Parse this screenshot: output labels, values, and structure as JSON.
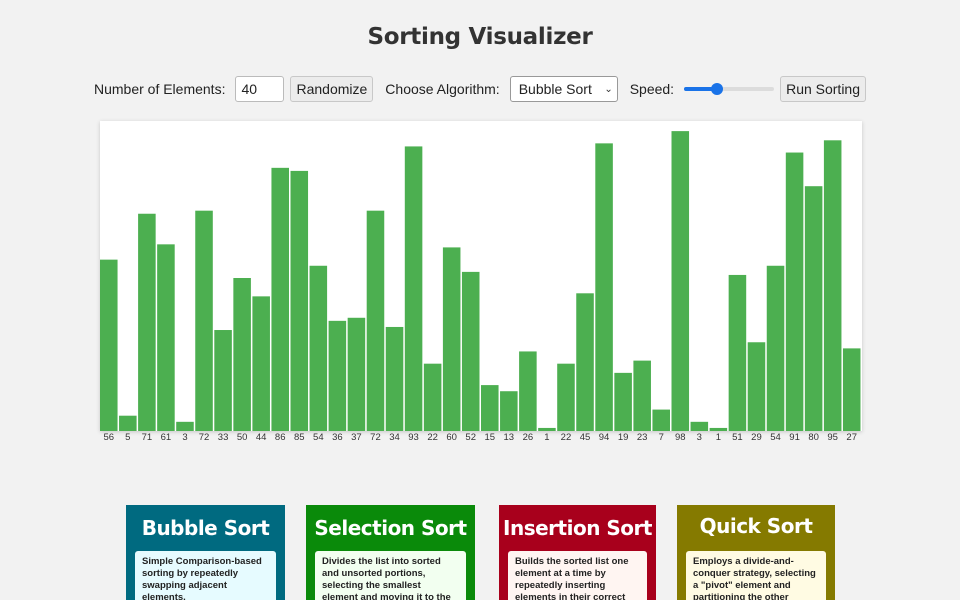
{
  "header": {
    "title": "Sorting Visualizer"
  },
  "controls": {
    "elements_label": "Number of Elements:",
    "elements_value": "40",
    "randomize_label": "Randomize",
    "algorithm_label": "Choose Algorithm:",
    "algorithm_selected": "Bubble Sort",
    "speed_label": "Speed:",
    "speed_level": 0.35,
    "run_label": "Run Sorting"
  },
  "colors": {
    "bar": "#4caf50",
    "accent": "#1a73e8",
    "bubble_header": "#006a80",
    "bubble_body": "#e6fbff",
    "selection_header": "#0a8a0a",
    "selection_body": "#f2fff0",
    "insertion_header": "#a8001c",
    "insertion_body": "#fff5f2",
    "quick_header": "#857a00",
    "quick_body": "#fffbe3"
  },
  "chart_data": {
    "type": "bar",
    "values": [
      56,
      5,
      71,
      61,
      3,
      72,
      33,
      50,
      44,
      86,
      85,
      54,
      36,
      37,
      72,
      34,
      93,
      22,
      60,
      52,
      15,
      13,
      26,
      1,
      22,
      45,
      94,
      19,
      23,
      7,
      98,
      3,
      1,
      51,
      29,
      54,
      91,
      80,
      95,
      27
    ],
    "ylim": [
      0,
      100
    ],
    "grid": false
  },
  "cards": [
    {
      "title": "Bubble Sort",
      "desc": "Simple Comparison-based sorting by repeatedly swapping adjacent elements."
    },
    {
      "title": "Selection Sort",
      "desc": "Divides the list into sorted and unsorted portions, selecting the smallest element and moving it to the sorted section."
    },
    {
      "title": "Insertion Sort",
      "desc": "Builds the sorted list one element at a time by repeatedly inserting elements in their correct positions."
    },
    {
      "title": "Quick Sort",
      "desc": "Employs a divide-and-conquer strategy, selecting a \"pivot\" element and partitioning the other elements around it."
    }
  ]
}
